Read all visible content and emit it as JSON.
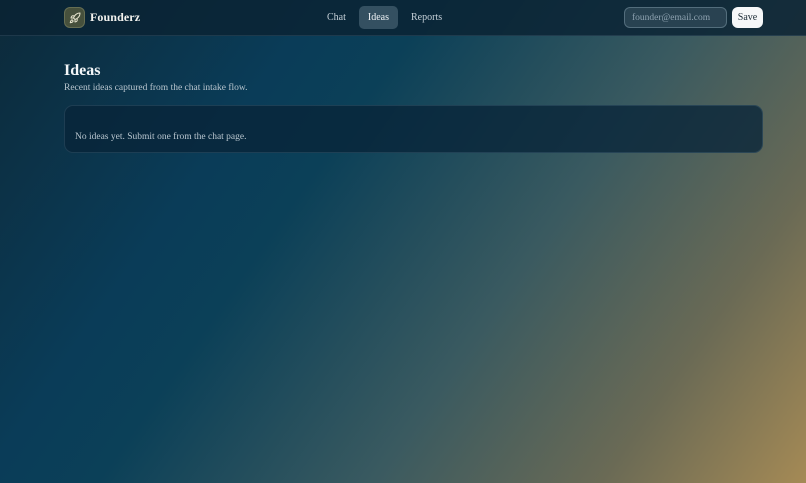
{
  "brand": {
    "name": "Founderz",
    "icon": "rocket-icon"
  },
  "nav": {
    "items": [
      {
        "label": "Chat",
        "active": false
      },
      {
        "label": "Ideas",
        "active": true
      },
      {
        "label": "Reports",
        "active": false
      }
    ]
  },
  "account": {
    "email_placeholder": "founder@email.com",
    "email_value": "",
    "save_label": "Save"
  },
  "page": {
    "title": "Ideas",
    "subtitle": "Recent ideas captured from the chat intake flow."
  },
  "ideas": {
    "items": [],
    "empty_message": "No ideas yet. Submit one from the chat page."
  },
  "colors": {
    "topbar": "#0a2334",
    "accent_active_tab": "#5a7688",
    "save_button_bg": "#f6f7f8",
    "panel": "#082438",
    "gradient_start": "#0a3c58",
    "gradient_end": "#a58a55"
  }
}
